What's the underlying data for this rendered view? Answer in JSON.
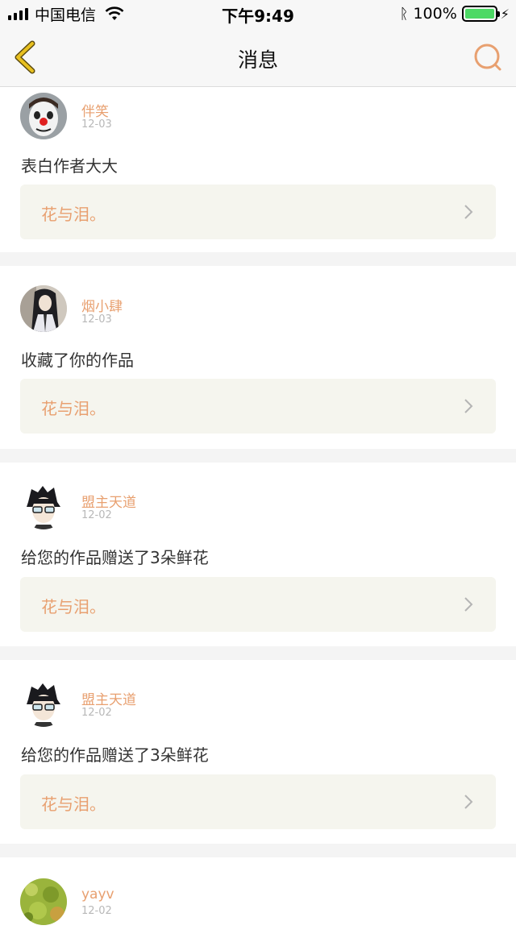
{
  "status_bar": {
    "carrier": "中国电信",
    "time": "下午9:49",
    "battery": "100%",
    "battery_level": 1.0
  },
  "nav": {
    "title": "消息",
    "back_icon": "chevron-left-icon",
    "search_icon": "search-icon"
  },
  "colors": {
    "accent": "#e8a070",
    "back_icon": "#e8c020",
    "work_bg": "#f5f5ee",
    "separator": "#f4f4f4"
  },
  "messages": [
    {
      "user": "伴笑",
      "date": "12-03",
      "text": "表白作者大大",
      "work": "花与泪。",
      "avatar": "clown-avatar"
    },
    {
      "user": "烟小肆",
      "date": "12-03",
      "text": "收藏了你的作品",
      "work": "花与泪。",
      "avatar": "anime-long-hair-avatar"
    },
    {
      "user": "盟主天道",
      "date": "12-02",
      "text": "给您的作品赠送了3朵鲜花",
      "work": "花与泪。",
      "avatar": "anime-glasses-avatar"
    },
    {
      "user": "盟主天道",
      "date": "12-02",
      "text": "给您的作品赠送了3朵鲜花",
      "work": "花与泪。",
      "avatar": "anime-glasses-avatar"
    },
    {
      "user": "yayv",
      "date": "12-02",
      "avatar": "green-texture-avatar"
    }
  ]
}
